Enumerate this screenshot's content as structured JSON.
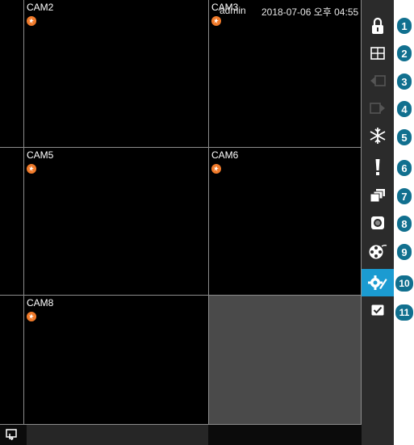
{
  "cameras": [
    {
      "label": "CAM2",
      "motion": true
    },
    {
      "label": "CAM3",
      "motion": true
    },
    {
      "label": "CAM5",
      "motion": true
    },
    {
      "label": "CAM6",
      "motion": true
    },
    {
      "label": "CAM8",
      "motion": true
    }
  ],
  "statusbar": {
    "user": "admin",
    "datetime": "2018-07-06 오후 04:55"
  },
  "sidebar": {
    "items": [
      {
        "icon": "lock-icon",
        "number": "1"
      },
      {
        "icon": "split-screen-icon",
        "number": "2"
      },
      {
        "icon": "previous-icon",
        "number": "3"
      },
      {
        "icon": "next-icon",
        "number": "4"
      },
      {
        "icon": "freeze-icon",
        "number": "5"
      },
      {
        "icon": "alarm-icon",
        "number": "6"
      },
      {
        "icon": "sequence-icon",
        "number": "7"
      },
      {
        "icon": "record-icon",
        "number": "8"
      },
      {
        "icon": "playback-icon",
        "number": "9"
      },
      {
        "icon": "settings-icon",
        "number": "10",
        "active": true
      },
      {
        "icon": "checkbox-icon",
        "number": "11"
      }
    ]
  },
  "colors": {
    "active": "#1b9bd1",
    "badge": "#11708f",
    "sidebar": "#2b2b2b",
    "motion": "#f07a2a"
  }
}
